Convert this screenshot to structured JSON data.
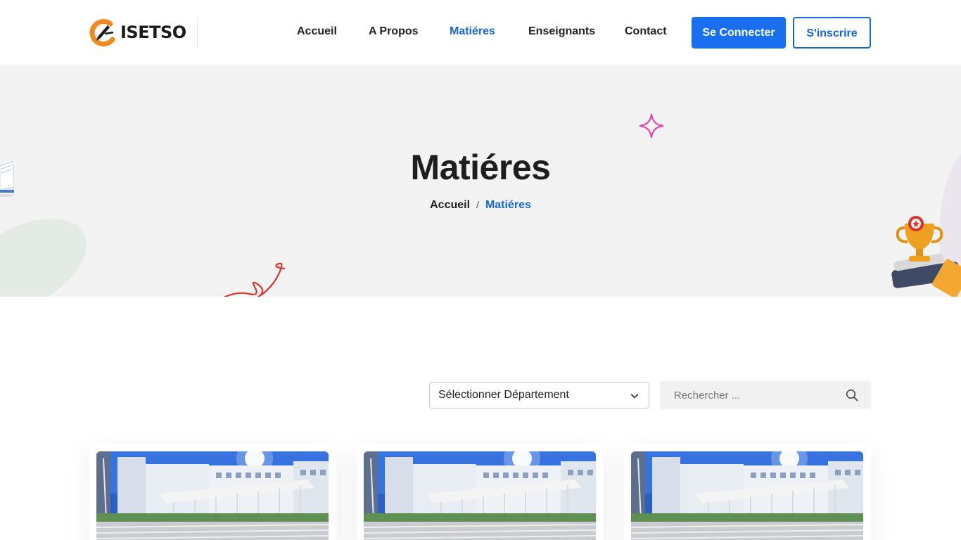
{
  "brand": {
    "name": "ISETSO"
  },
  "nav": {
    "items": [
      {
        "label": "Accueil",
        "active": false
      },
      {
        "label": "A Propos",
        "active": false
      },
      {
        "label": "Matiéres",
        "active": true
      },
      {
        "label": "Enseignants",
        "active": false
      },
      {
        "label": "Contact",
        "active": false
      }
    ],
    "login_label": "Se Connecter",
    "signup_label": "S'inscrire"
  },
  "hero": {
    "title": "Matiéres",
    "breadcrumb": {
      "home": "Accueil",
      "separator": "/",
      "current": "Matiéres"
    }
  },
  "filters": {
    "department_selected": "Sélectionner Département",
    "search_placeholder": "Rechercher ..."
  },
  "cards": [
    {
      "image": "campus-building-photo"
    },
    {
      "image": "campus-building-photo"
    },
    {
      "image": "campus-building-photo"
    }
  ],
  "colors": {
    "accent": "#1565d8",
    "button_primary": "#1a6ff0",
    "hero_bg": "#f3f3f3",
    "logo_orange": "#f18a1e",
    "sparkle_pink": "#e53ab3",
    "swirl_red": "#d8322a"
  }
}
